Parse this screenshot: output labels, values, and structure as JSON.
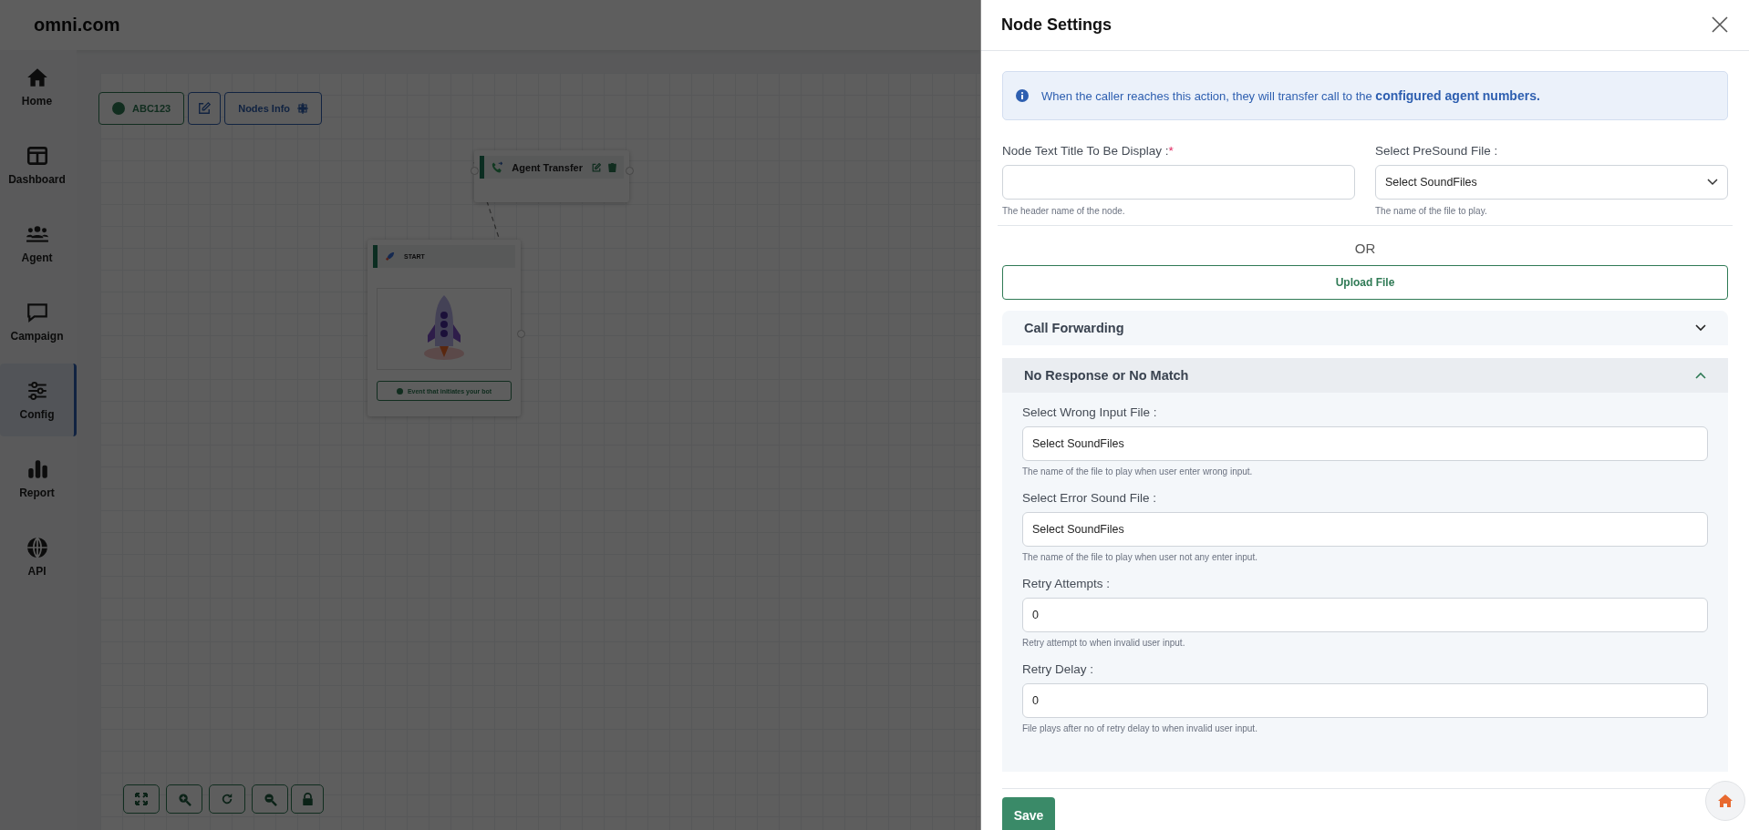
{
  "header": {
    "logo": "omni.com"
  },
  "sidebar": {
    "items": [
      {
        "label": "Home",
        "selected": false
      },
      {
        "label": "Dashboard",
        "selected": false
      },
      {
        "label": "Agent",
        "selected": false
      },
      {
        "label": "Campaign",
        "selected": false
      },
      {
        "label": "Config",
        "selected": true
      },
      {
        "label": "Report",
        "selected": false
      },
      {
        "label": "API",
        "selected": false
      }
    ]
  },
  "canvas": {
    "flow_name": "ABC123",
    "nodes_info": "Nodes Info",
    "nodes": [
      {
        "kind": "agent",
        "title": "Agent Transfer"
      },
      {
        "kind": "start",
        "title": "START",
        "event": "Event that initiates your bot"
      }
    ]
  },
  "panel": {
    "title": "Node Settings",
    "info": "When the caller reaches this action, they will transfer call to the **configured agent numbers.**",
    "fields": [
      {
        "kind": "input",
        "label": "Node Text Title To Be Display :",
        "required_mark": "*",
        "hint": "The header name of the node."
      },
      {
        "kind": "select",
        "label": "Select PreSound File :",
        "value": "Select SoundFiles",
        "hint": "The name of the file to play."
      }
    ],
    "or": "OR",
    "upload": "Upload File",
    "sections": [
      {
        "title": "Call Forwarding",
        "expanded": false
      },
      {
        "title": "No Response or No Match",
        "expanded": true,
        "fields": [
          {
            "kind": "input",
            "label": "Select Wrong Input File :",
            "value": "Select SoundFiles",
            "hint": "The name of the file to play when user enter wrong input."
          },
          {
            "kind": "input",
            "label": "Select Error Sound File :",
            "value": "Select SoundFiles",
            "hint": "The name of the file to play when user not any enter input."
          },
          {
            "kind": "input",
            "label": "Retry Attempts :",
            "value": "0",
            "hint": "Retry attempt to when invalid user input."
          },
          {
            "kind": "input",
            "label": "Retry Delay :",
            "value": "0",
            "hint": "File plays after no of retry delay to when invalid user input."
          }
        ]
      }
    ],
    "save": "Save"
  }
}
